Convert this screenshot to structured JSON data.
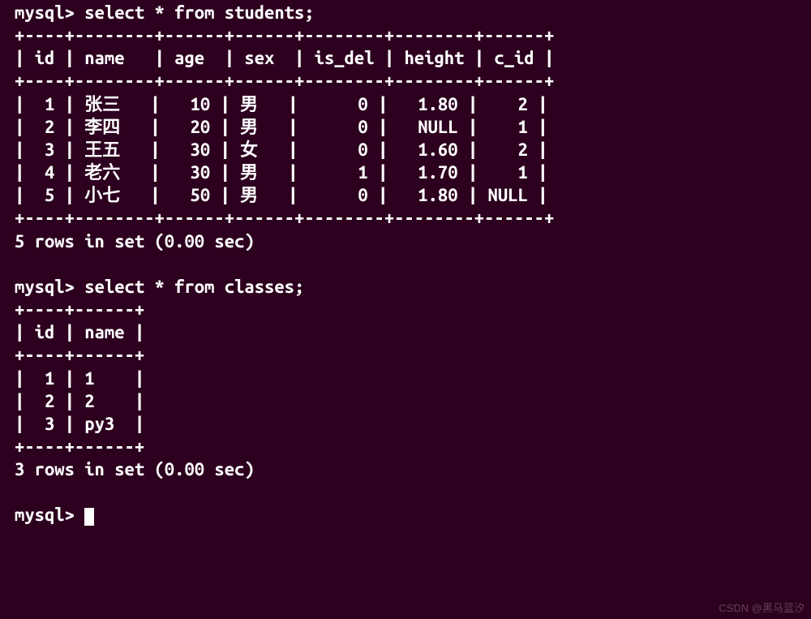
{
  "prompt": "mysql>",
  "queries": {
    "students": {
      "sql": "select * from students;",
      "columns": [
        "id",
        "name",
        "age",
        "sex",
        "is_del",
        "height",
        "c_id"
      ],
      "rows": [
        {
          "id": 1,
          "name": "张三",
          "age": 10,
          "sex": "男",
          "is_del": 0,
          "height": "1.80",
          "c_id": "2"
        },
        {
          "id": 2,
          "name": "李四",
          "age": 20,
          "sex": "男",
          "is_del": 0,
          "height": "NULL",
          "c_id": "1"
        },
        {
          "id": 3,
          "name": "王五",
          "age": 30,
          "sex": "女",
          "is_del": 0,
          "height": "1.60",
          "c_id": "2"
        },
        {
          "id": 4,
          "name": "老六",
          "age": 30,
          "sex": "男",
          "is_del": 1,
          "height": "1.70",
          "c_id": "1"
        },
        {
          "id": 5,
          "name": "小七",
          "age": 50,
          "sex": "男",
          "is_del": 0,
          "height": "1.80",
          "c_id": "NULL"
        }
      ],
      "footer": "5 rows in set (0.00 sec)"
    },
    "classes": {
      "sql": "select * from classes;",
      "columns": [
        "id",
        "name"
      ],
      "rows": [
        {
          "id": 1,
          "name": "1"
        },
        {
          "id": 2,
          "name": "2"
        },
        {
          "id": 3,
          "name": "py3"
        }
      ],
      "footer": "3 rows in set (0.00 sec)"
    }
  },
  "watermark": "CSDN @黑马蓝汐"
}
